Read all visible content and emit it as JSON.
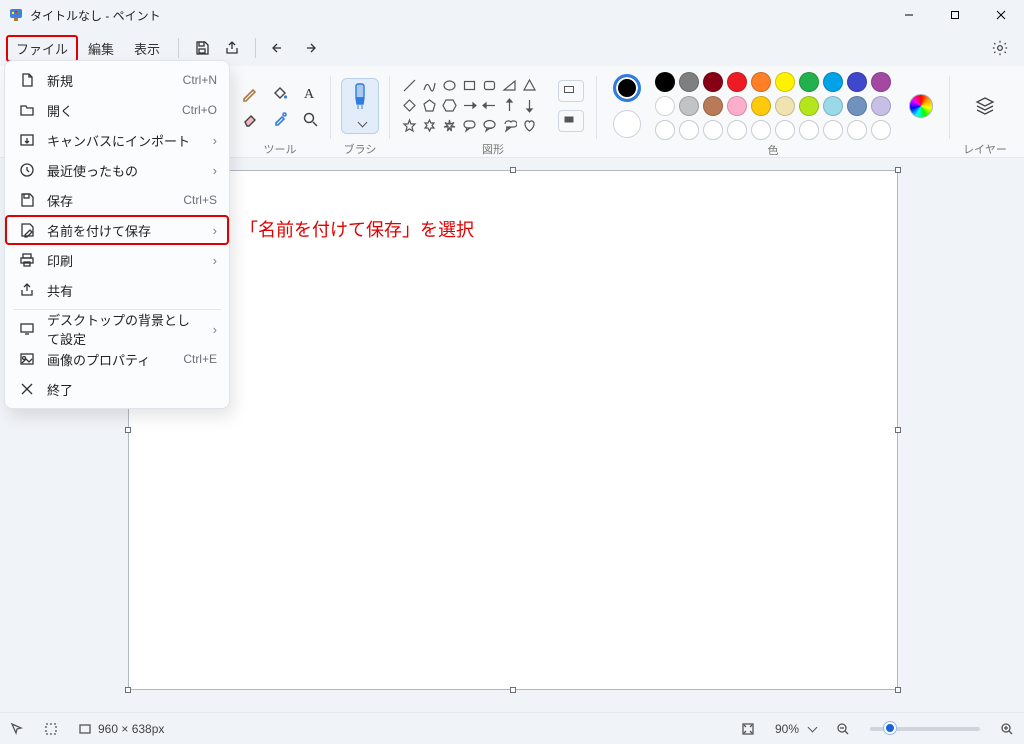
{
  "titlebar": {
    "title": "タイトルなし - ペイント"
  },
  "menubar": {
    "file": "ファイル",
    "edit": "編集",
    "view": "表示"
  },
  "ribbon": {
    "tools_label": "ツール",
    "brush_label": "ブラシ",
    "shapes_label": "図形",
    "color_label": "色",
    "layers_label": "レイヤー"
  },
  "colors": {
    "row1": [
      "#000000",
      "#7f7f7f",
      "#880015",
      "#ed1c24",
      "#ff7f27",
      "#fff200",
      "#22b14c",
      "#00a2e8",
      "#3f48cc",
      "#a349a4"
    ],
    "row2": [
      "#ffffff",
      "#c3c3c3",
      "#b97a57",
      "#ffaec9",
      "#ffc90e",
      "#efe4b0",
      "#b5e61d",
      "#99d9ea",
      "#7092be",
      "#c8bfe7"
    ]
  },
  "file_menu": {
    "new": {
      "label": "新規",
      "accel": "Ctrl+N"
    },
    "open": {
      "label": "開く",
      "accel": "Ctrl+O"
    },
    "import": {
      "label": "キャンバスにインポート"
    },
    "recent": {
      "label": "最近使ったもの"
    },
    "save": {
      "label": "保存",
      "accel": "Ctrl+S"
    },
    "save_as": {
      "label": "名前を付けて保存"
    },
    "print": {
      "label": "印刷"
    },
    "share": {
      "label": "共有"
    },
    "set_bg": {
      "label": "デスクトップの背景として設定"
    },
    "props": {
      "label": "画像のプロパティ",
      "accel": "Ctrl+E"
    },
    "exit": {
      "label": "終了"
    }
  },
  "annotation": {
    "text": "「名前を付けて保存」を選択"
  },
  "statusbar": {
    "canvas_size": "960 × 638px",
    "zoom": "90%"
  }
}
